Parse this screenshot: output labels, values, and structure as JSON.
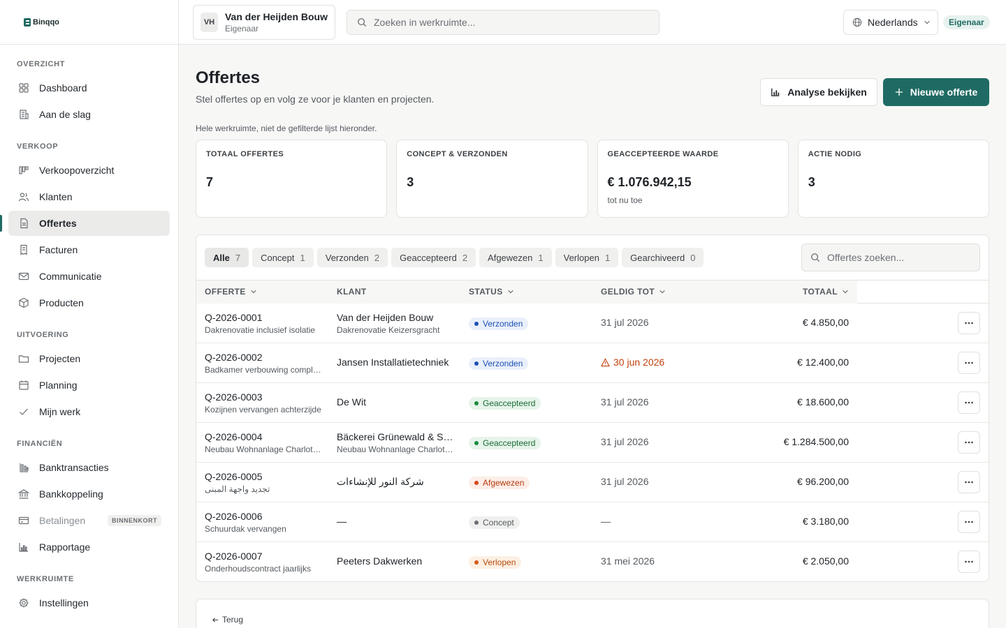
{
  "brand": {
    "name": "Binqqo",
    "accent": "#1f6b63"
  },
  "sidebar": {
    "sections": [
      {
        "title": "OVERZICHT",
        "items": [
          {
            "label": "Dashboard",
            "icon": "dashboard-icon"
          },
          {
            "label": "Aan de slag",
            "icon": "building-icon"
          }
        ]
      },
      {
        "title": "VERKOOP",
        "items": [
          {
            "label": "Verkoopoverzicht",
            "icon": "pipeline-icon"
          },
          {
            "label": "Klanten",
            "icon": "users-icon"
          },
          {
            "label": "Offertes",
            "icon": "document-icon",
            "active": true
          },
          {
            "label": "Facturen",
            "icon": "receipt-icon"
          },
          {
            "label": "Communicatie",
            "icon": "mail-icon"
          },
          {
            "label": "Producten",
            "icon": "box-icon"
          }
        ]
      },
      {
        "title": "UITVOERING",
        "items": [
          {
            "label": "Projecten",
            "icon": "folder-icon"
          },
          {
            "label": "Planning",
            "icon": "calendar-icon"
          },
          {
            "label": "Mijn werk",
            "icon": "check-icon"
          }
        ]
      },
      {
        "title": "FINANCIËN",
        "items": [
          {
            "label": "Banktransacties",
            "icon": "transactions-icon"
          },
          {
            "label": "Bankkoppeling",
            "icon": "bank-icon"
          },
          {
            "label": "Betalingen",
            "icon": "card-icon",
            "badge": "BINNENKORT",
            "disabled": true
          },
          {
            "label": "Rapportage",
            "icon": "chart-icon"
          }
        ]
      },
      {
        "title": "WERKRUIMTE",
        "items": [
          {
            "label": "Instellingen",
            "icon": "gear-icon"
          }
        ]
      }
    ]
  },
  "topbar": {
    "workspace": {
      "initials": "VH",
      "name": "Van der Heijden Bouw",
      "role": "Eigenaar"
    },
    "search_placeholder": "Zoeken in werkruimte...",
    "language": "Nederlands",
    "role_badge": "Eigenaar"
  },
  "page": {
    "title": "Offertes",
    "subtitle": "Stel offertes op en volg ze voor je klanten en projecten.",
    "analyse_button": "Analyse bekijken",
    "new_button": "Nieuwe offerte",
    "stats_note": "Hele werkruimte, niet de gefilterde lijst hieronder."
  },
  "stats": [
    {
      "label": "TOTAAL OFFERTES",
      "value": "7",
      "sub": ""
    },
    {
      "label": "CONCEPT & VERZONDEN",
      "value": "3",
      "sub": ""
    },
    {
      "label": "GEACCEPTEERDE WAARDE",
      "value": "€ 1.076.942,15",
      "sub": "tot nu toe"
    },
    {
      "label": "ACTIE NODIG",
      "value": "3",
      "sub": ""
    }
  ],
  "filters": [
    {
      "label": "Alle",
      "count": "7",
      "active": true
    },
    {
      "label": "Concept",
      "count": "1"
    },
    {
      "label": "Verzonden",
      "count": "2"
    },
    {
      "label": "Geaccepteerd",
      "count": "2"
    },
    {
      "label": "Afgewezen",
      "count": "1"
    },
    {
      "label": "Verlopen",
      "count": "1"
    },
    {
      "label": "Gearchiveerd",
      "count": "0"
    }
  ],
  "table_search_placeholder": "Offertes zoeken...",
  "columns": {
    "quote": "OFFERTE",
    "customer": "KLANT",
    "status": "STATUS",
    "valid": "GELDIG TOT",
    "total": "TOTAAL"
  },
  "rows": [
    {
      "id": "Q-2026-0001",
      "desc": "Dakrenovatie inclusief isolatie",
      "customer": "Van der Heijden Bouw",
      "project": "Dakrenovatie Keizersgracht",
      "status": "Verzonden",
      "status_kind": "sent",
      "valid": "31 jul 2026",
      "warn": false,
      "total": "€ 4.850,00"
    },
    {
      "id": "Q-2026-0002",
      "desc": "Badkamer verbouwing complete",
      "customer": "Jansen Installatietechniek",
      "project": "",
      "status": "Verzonden",
      "status_kind": "sent",
      "valid": "30 jun 2026",
      "warn": true,
      "total": "€ 12.400,00"
    },
    {
      "id": "Q-2026-0003",
      "desc": "Kozijnen vervangen achterzijde",
      "customer": "De Wit",
      "project": "",
      "status": "Geaccepteerd",
      "status_kind": "acc",
      "valid": "31 jul 2026",
      "warn": false,
      "total": "€ 18.600,00"
    },
    {
      "id": "Q-2026-0004",
      "desc": "Neubau Wohnanlage Charlottenburg",
      "customer": "Bäckerei Grünewald & Söhne",
      "project": "Neubau Wohnanlage Charlottenburg",
      "status": "Geaccepteerd",
      "status_kind": "acc",
      "valid": "31 jul 2026",
      "warn": false,
      "total": "€ 1.284.500,00"
    },
    {
      "id": "Q-2026-0005",
      "desc": "تجديد واجهة المبنى",
      "customer": "شركة النور للإنشاءات",
      "project": "",
      "status": "Afgewezen",
      "status_kind": "rej",
      "valid": "31 jul 2026",
      "warn": false,
      "total": "€ 96.200,00"
    },
    {
      "id": "Q-2026-0006",
      "desc": "Schuurdak vervangen",
      "customer": "—",
      "project": "",
      "status": "Concept",
      "status_kind": "con",
      "valid": "—",
      "warn": false,
      "total": "€ 3.180,00"
    },
    {
      "id": "Q-2026-0007",
      "desc": "Onderhoudscontract jaarlijks",
      "customer": "Peeters Dakwerken",
      "project": "",
      "status": "Verlopen",
      "status_kind": "exp",
      "valid": "31 mei 2026",
      "warn": false,
      "total": "€ 2.050,00"
    }
  ],
  "footer": {
    "back_label": "Terug"
  }
}
